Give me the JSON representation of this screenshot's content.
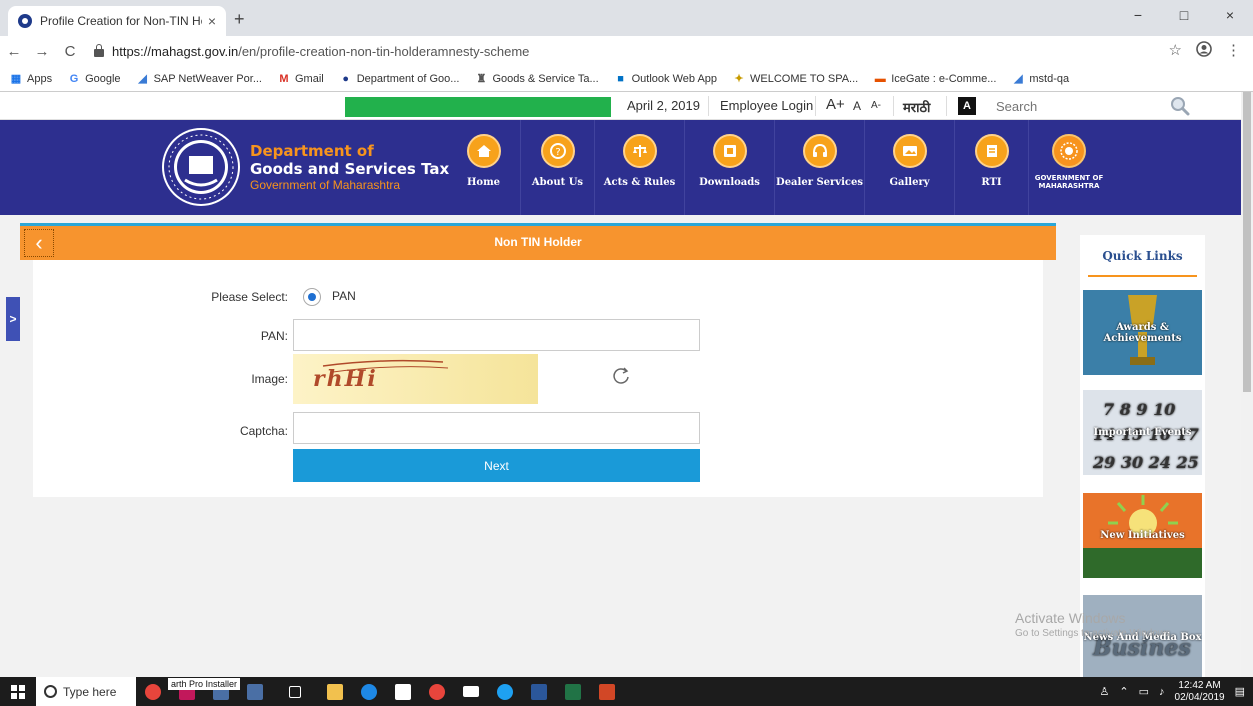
{
  "browser": {
    "tab_title": "Profile Creation for Non-TIN Hol ",
    "tab_close": "×",
    "new_tab": "+",
    "url_host": "https://mahagst.gov.in",
    "url_path": "/en/profile-creation-non-tin-holderamnesty-scheme",
    "back": "←",
    "forward": "→",
    "reload": "C",
    "star": "☆",
    "menu": "⋮",
    "win_min": "−",
    "win_max": "□",
    "win_close": "×"
  },
  "bookmarks": [
    {
      "icon": "▦",
      "label": "Apps",
      "color": "#1a73e8"
    },
    {
      "icon": "G",
      "label": "Google",
      "color": "#4285f4"
    },
    {
      "icon": "◢",
      "label": "SAP NetWeaver Por...",
      "color": "#3a7bd5"
    },
    {
      "icon": "M",
      "label": "Gmail",
      "color": "#d93025"
    },
    {
      "icon": "●",
      "label": "Department of Goo...",
      "color": "#1e3a8a"
    },
    {
      "icon": "♜",
      "label": "Goods & Service Ta...",
      "color": "#555555"
    },
    {
      "icon": "■",
      "label": "Outlook Web App",
      "color": "#0072c6"
    },
    {
      "icon": "✦",
      "label": "WELCOME TO SPA...",
      "color": "#c89b00"
    },
    {
      "icon": "▬",
      "label": "IceGate : e-Comme...",
      "color": "#e65100"
    },
    {
      "icon": "◢",
      "label": "mstd-qa",
      "color": "#3a7bd5"
    }
  ],
  "topstrip": {
    "date": "April 2, 2019",
    "employee_login": "Employee Login",
    "font_large": "A+",
    "font_normal": "A",
    "font_small": "A-",
    "language": "मराठी",
    "contrast": "A",
    "search_placeholder": "Search"
  },
  "header": {
    "title_line1": "Department of",
    "title_line2": "Goods and Services Tax",
    "subtitle": "Government of Maharashtra",
    "nav": [
      {
        "label": "Home"
      },
      {
        "label": "About Us"
      },
      {
        "label": "Acts & Rules"
      },
      {
        "label": "Downloads"
      },
      {
        "label": "Dealer Services"
      },
      {
        "label": "Gallery"
      },
      {
        "label": "RTI"
      }
    ],
    "gov_label_1": "GOVERNMENT OF",
    "gov_label_2": "MAHARASHTRA"
  },
  "form": {
    "page_title": "Non TIN Holder",
    "back_glyph": "‹",
    "please_select_label": "Please Select:",
    "radio_label": "PAN",
    "pan_label": "PAN:",
    "pan_value": "",
    "image_label": "Image:",
    "captcha_text": "rhHi",
    "captcha_label": "Captcha:",
    "captcha_value": "",
    "next_label": "Next"
  },
  "sidebar_toggle": ">",
  "quick_links": {
    "title": "Quick Links",
    "cards": [
      {
        "label": "Awards & Achievements",
        "bg": "#3b7fa8"
      },
      {
        "label": "Important Events",
        "bg": "#8fa7bf"
      },
      {
        "label": "New Initiatives",
        "bg": "#e8732a"
      },
      {
        "label": "News And Media Box",
        "bg": "#7d93a8"
      }
    ]
  },
  "watermark": {
    "line1": "Activate Windows",
    "line2": "Go to Settings to activate Windows."
  },
  "taskbar": {
    "search_text": "Type here",
    "tooltip": "arth Pro Installer",
    "time": "12:42 AM",
    "date": "02/04/2019"
  }
}
